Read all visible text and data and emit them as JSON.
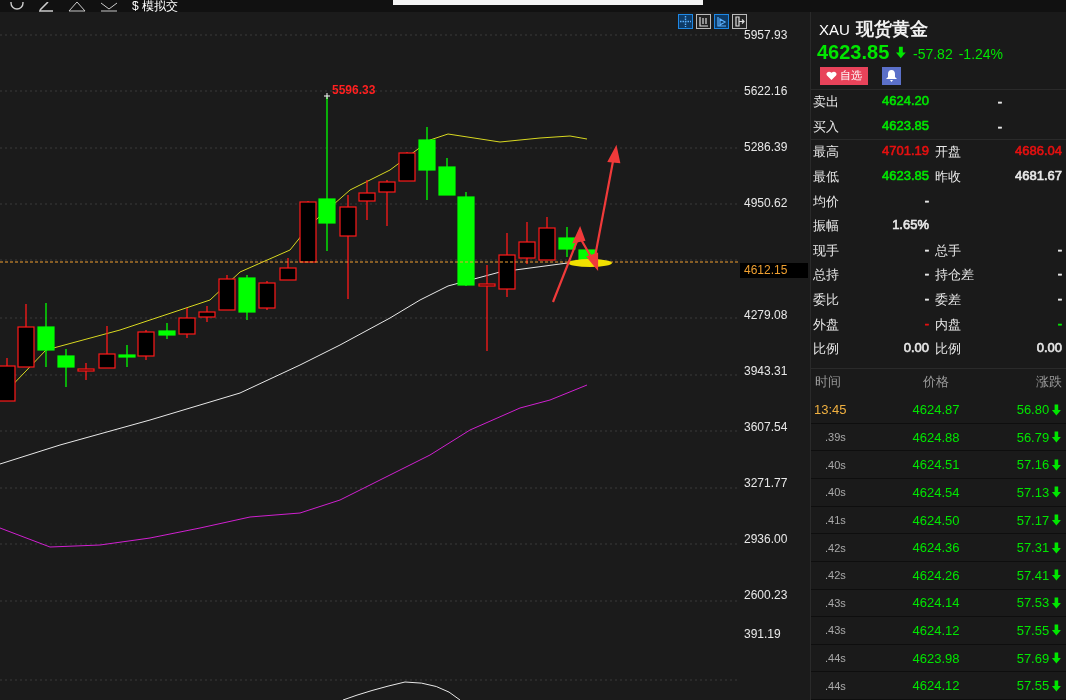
{
  "toolbar": {
    "label": "$ 模拟交"
  },
  "chart": {
    "tools": [
      {
        "selected": true
      },
      {
        "selected": false
      },
      {
        "selected": true
      },
      {
        "selected": false
      }
    ],
    "peak_label": "5596.33",
    "price_ticks": [
      "5957.93",
      "5622.16",
      "5286.39",
      "4950.62",
      "4279.08",
      "3943.31",
      "3607.54",
      "3271.77",
      "2936.00",
      "2600.23"
    ],
    "current_price": "4612.15",
    "indicator_tick": "391.19"
  },
  "quote": {
    "symbol": "XAU",
    "name": "现货黄金",
    "price": "4623.85",
    "falling": true,
    "change": "-57.82",
    "change_pct": "-1.24%",
    "watch_label": "自选"
  },
  "stats": [
    {
      "left": {
        "label": "卖出",
        "value": "4624.20",
        "color": "#00e600"
      },
      "right": {
        "value": "-",
        "color": "#e8e8e8"
      },
      "divider": false
    },
    {
      "left": {
        "label": "买入",
        "value": "4623.85",
        "color": "#00e600"
      },
      "right": {
        "value": "-",
        "color": "#e8e8e8"
      },
      "divider": true
    },
    {
      "left": {
        "label": "最高",
        "value": "4701.19",
        "color": "#e61010"
      },
      "right": {
        "label": "开盘",
        "value": "4686.04",
        "color": "#e61010"
      },
      "divider": false
    },
    {
      "left": {
        "label": "最低",
        "value": "4623.85",
        "color": "#00e600"
      },
      "right": {
        "label": "昨收",
        "value": "4681.67",
        "color": "#e8e8e8"
      },
      "divider": false
    },
    {
      "left": {
        "label": "均价",
        "value": "-",
        "color": "#e8e8e8"
      },
      "divider": false
    },
    {
      "left": {
        "label": "振幅",
        "value": "1.65%",
        "color": "#e8e8e8"
      },
      "divider": false
    },
    {
      "left": {
        "label": "现手",
        "value": "-",
        "color": "#e8e8e8"
      },
      "right": {
        "label": "总手",
        "value": "-",
        "color": "#e8e8e8"
      },
      "divider": false
    },
    {
      "left": {
        "label": "总持",
        "value": "-",
        "color": "#e8e8e8"
      },
      "right": {
        "label": "持仓差",
        "value": "-",
        "color": "#e8e8e8"
      },
      "divider": false
    },
    {
      "left": {
        "label": "委比",
        "value": "-",
        "color": "#e8e8e8"
      },
      "right": {
        "label": "委差",
        "value": "-",
        "color": "#e8e8e8"
      },
      "divider": false
    },
    {
      "left": {
        "label": "外盘",
        "value": "-",
        "color": "#e61010"
      },
      "right": {
        "label": "内盘",
        "value": "-",
        "color": "#00e600"
      },
      "divider": false
    },
    {
      "left": {
        "label": "比例",
        "value": "0.00",
        "color": "#e8e8e8"
      },
      "right": {
        "label": "比例",
        "value": "0.00",
        "color": "#e8e8e8"
      },
      "divider": false
    }
  ],
  "ticks_table": {
    "columns": [
      "时间",
      "价格",
      "涨跌"
    ],
    "rows": [
      {
        "kind": "minute",
        "time": "13:45",
        "price": "4624.87",
        "change": "56.80",
        "falling": true
      },
      {
        "kind": "second",
        "time": ".39s",
        "price": "4624.88",
        "change": "56.79",
        "falling": true
      },
      {
        "kind": "second",
        "time": ".40s",
        "price": "4624.51",
        "change": "57.16",
        "falling": true
      },
      {
        "kind": "second",
        "time": ".40s",
        "price": "4624.54",
        "change": "57.13",
        "falling": true
      },
      {
        "kind": "second",
        "time": ".41s",
        "price": "4624.50",
        "change": "57.17",
        "falling": true
      },
      {
        "kind": "second",
        "time": ".42s",
        "price": "4624.36",
        "change": "57.31",
        "falling": true
      },
      {
        "kind": "second",
        "time": ".42s",
        "price": "4624.26",
        "change": "57.41",
        "falling": true
      },
      {
        "kind": "second",
        "time": ".43s",
        "price": "4624.14",
        "change": "57.53",
        "falling": true
      },
      {
        "kind": "second",
        "time": ".43s",
        "price": "4624.12",
        "change": "57.55",
        "falling": true
      },
      {
        "kind": "second",
        "time": ".44s",
        "price": "4623.98",
        "change": "57.69",
        "falling": true
      },
      {
        "kind": "second",
        "time": ".44s",
        "price": "4624.12",
        "change": "57.55",
        "falling": true
      }
    ]
  }
}
